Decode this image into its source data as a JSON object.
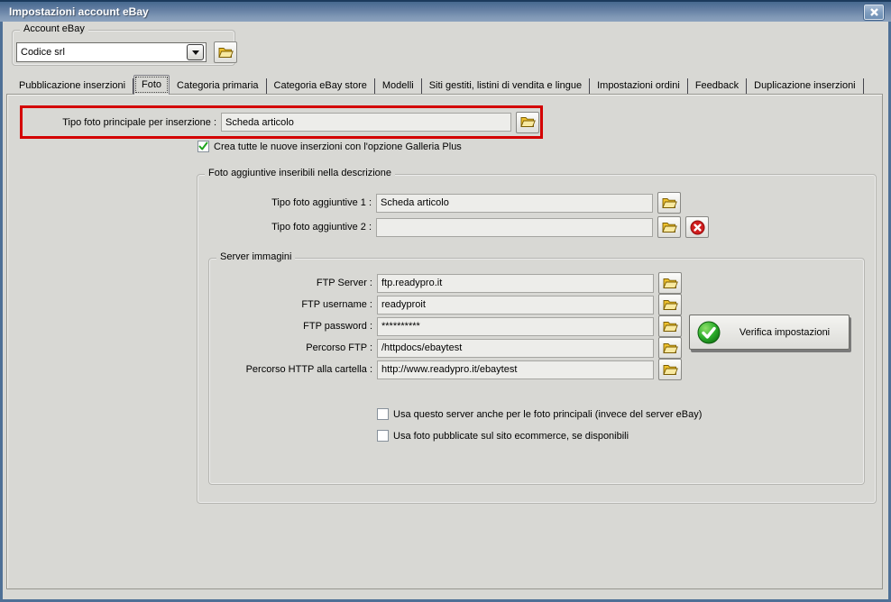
{
  "window": {
    "title": "Impostazioni account eBay"
  },
  "account": {
    "group_label": "Account eBay",
    "selected_value": "Codice srl"
  },
  "tabs": [
    {
      "label": "Pubblicazione inserzioni",
      "selected": false
    },
    {
      "label": "Foto",
      "selected": true
    },
    {
      "label": "Categoria primaria",
      "selected": false
    },
    {
      "label": "Categoria eBay store",
      "selected": false
    },
    {
      "label": "Modelli",
      "selected": false
    },
    {
      "label": "Siti gestiti, listini di vendita e lingue",
      "selected": false
    },
    {
      "label": "Impostazioni ordini",
      "selected": false
    },
    {
      "label": "Feedback",
      "selected": false
    },
    {
      "label": "Duplicazione inserzioni",
      "selected": false
    }
  ],
  "photo_tab": {
    "main_photo_label": "Tipo foto principale per inserzione :",
    "main_photo_value": "Scheda articolo",
    "gallery_plus_label": "Crea tutte le nuove inserzioni con l'opzione Galleria Plus",
    "gallery_plus_checked": true,
    "additional_group": {
      "label": "Foto aggiuntive inseribili nella descrizione",
      "rows": [
        {
          "label": "Tipo foto aggiuntive 1 :",
          "value": "Scheda articolo"
        },
        {
          "label": "Tipo foto aggiuntive 2 :",
          "value": ""
        }
      ]
    },
    "server_group": {
      "label": "Server immagini",
      "rows": [
        {
          "label": "FTP Server :",
          "value": "ftp.readypro.it"
        },
        {
          "label": "FTP username :",
          "value": "readyproit"
        },
        {
          "label": "FTP password :",
          "value": "**********"
        },
        {
          "label": "Percorso FTP :",
          "value": "/httpdocs/ebaytest"
        },
        {
          "label": "Percorso HTTP alla cartella :",
          "value": "http://www.readypro.it/ebaytest"
        }
      ],
      "verify_button_label": "Verifica impostazioni",
      "checkboxes": [
        {
          "label": "Usa questo server anche per le foto principali (invece del server eBay)",
          "checked": false
        },
        {
          "label": "Usa foto pubblicate sul sito ecommerce, se disponibili",
          "checked": false
        }
      ]
    }
  },
  "colors": {
    "highlight_red": "#d40000",
    "folder_gold": "#eec12e",
    "check_green": "#2ca02c",
    "delete_red": "#cf1d1d",
    "titlebar_blue": "#647fa3"
  }
}
